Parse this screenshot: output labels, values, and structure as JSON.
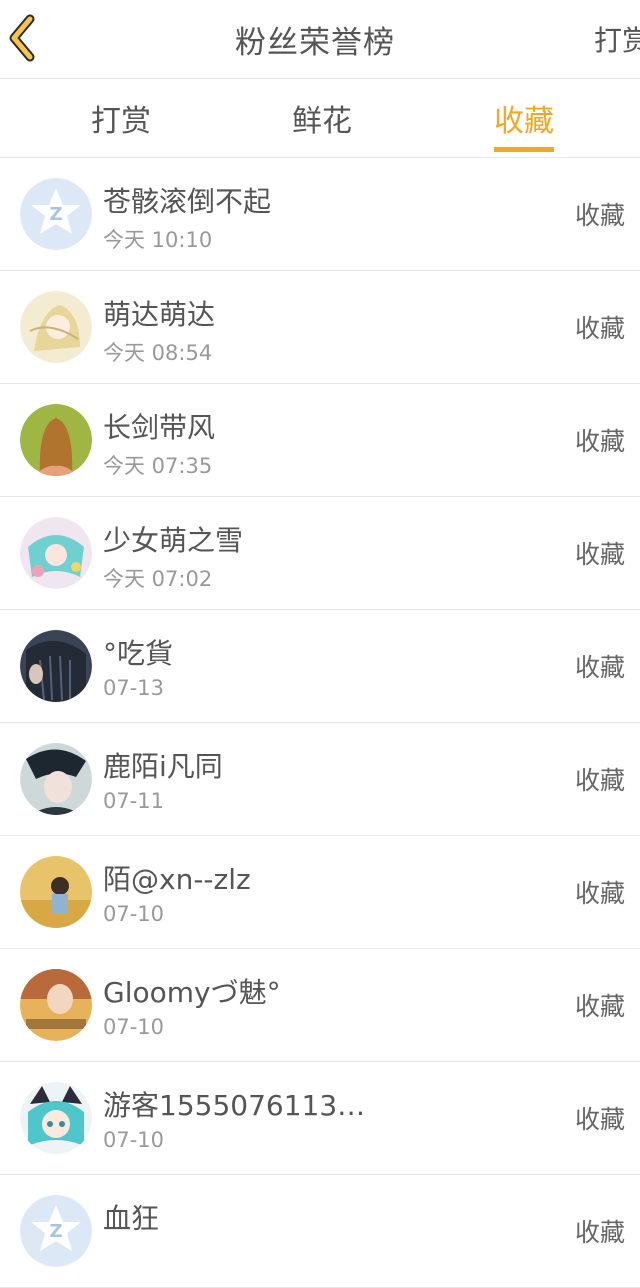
{
  "header": {
    "title": "粉丝荣誉榜",
    "right_action": "打赏",
    "back_icon": "chevron-left-icon",
    "accent": "#f5a623"
  },
  "tabs": [
    {
      "label": "打赏",
      "active": false
    },
    {
      "label": "鲜花",
      "active": false
    },
    {
      "label": "收藏",
      "active": true
    }
  ],
  "list": [
    {
      "name": "苍骸滚倒不起",
      "time": "今天 10:10",
      "action": "收藏",
      "avatar": "default-star-avatar"
    },
    {
      "name": "萌达萌达",
      "time": "今天 08:54",
      "action": "收藏",
      "avatar": "anime-girl-avatar"
    },
    {
      "name": "长剑带风",
      "time": "今天 07:35",
      "action": "收藏",
      "avatar": "girl-back-avatar"
    },
    {
      "name": "少女萌之雪",
      "time": "今天 07:02",
      "action": "收藏",
      "avatar": "anime-colorful-avatar"
    },
    {
      "name": "°吃貨",
      "time": "07-13",
      "action": "收藏",
      "avatar": "dark-hair-avatar"
    },
    {
      "name": "鹿陌i凡同",
      "time": "07-11",
      "action": "收藏",
      "avatar": "boy-avatar"
    },
    {
      "name": "陌@xn--zlz",
      "time": "07-10",
      "action": "收藏",
      "avatar": "field-avatar"
    },
    {
      "name": "Gloomyづ魅°",
      "time": "07-10",
      "action": "收藏",
      "avatar": "warm-avatar"
    },
    {
      "name": "游客1555076113…",
      "time": "07-10",
      "action": "收藏",
      "avatar": "anime-blue-avatar"
    },
    {
      "name": "血狂",
      "time": "",
      "action": "收藏",
      "avatar": "default-star-avatar"
    }
  ]
}
